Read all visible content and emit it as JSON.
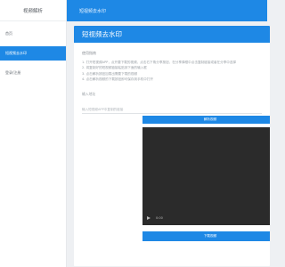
{
  "sidebar": {
    "title": "视频解析",
    "items": [
      {
        "label": "首页"
      },
      {
        "label": "短视频去水印"
      },
      {
        "label": "登录/注册"
      }
    ]
  },
  "topbar": {
    "title": "短视频去水印"
  },
  "card": {
    "title": "短视频去水印",
    "usage_label": "使用指南",
    "steps": [
      "1. 打开短视频APP，点开要下载的视频，点击右下角分享按钮，在分享弹框中点击复制链接或者在分享中选择",
      "2. 将复制好的短视频链接粘贴到下面的输入框",
      "3. 点击解析按钮加载出需要下载的视频",
      "4. 点击解析视频的下载按钮即可保存到手机中打开"
    ],
    "input_label": "输入地址",
    "input_placeholder": "输入短视频APP中复制的链接",
    "parse_button": "解析视频",
    "video_time": "0:00",
    "download_button": "下载视频"
  },
  "colors": {
    "accent": "#1e88e5",
    "video_bg": "#2b2b2b"
  }
}
